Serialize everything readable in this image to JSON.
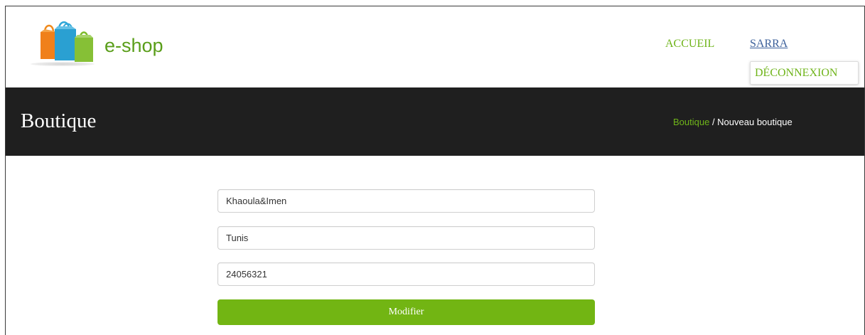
{
  "header": {
    "logo_text": "e-shop",
    "nav": {
      "home_label": "ACCUEIL",
      "user_label": "SARRA"
    },
    "dropdown": {
      "logout_label": "DÉCONNEXION"
    }
  },
  "banner": {
    "title": "Boutique",
    "breadcrumb": {
      "link_label": "Boutique",
      "separator": " / ",
      "current_label": "Nouveau boutique"
    }
  },
  "form": {
    "name_value": "Khaoula&Imen",
    "city_value": "Tunis",
    "phone_value": "24056321",
    "submit_label": "Modifier"
  },
  "colors": {
    "accent_green": "#72b513",
    "banner_bg": "#1f1f1f",
    "link_blue": "#3b5f9a"
  },
  "icons": {
    "logo": "shopping-bags-icon"
  }
}
